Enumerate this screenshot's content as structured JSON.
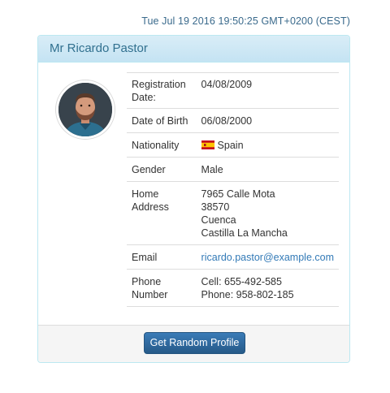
{
  "timestamp": "Tue Jul 19 2016 19:50:25 GMT+0200 (CEST)",
  "profile": {
    "name": "Mr Ricardo Pastor",
    "rows": {
      "registration": {
        "label": "Registration Date:",
        "value": "04/08/2009"
      },
      "dob": {
        "label": "Date of Birth",
        "value": "06/08/2000"
      },
      "nationality": {
        "label": "Nationality",
        "value": "Spain",
        "flag_icon": "spain-flag-icon"
      },
      "gender": {
        "label": "Gender",
        "value": "Male"
      },
      "address": {
        "label": "Home Address",
        "lines": [
          "7965 Calle Mota",
          "38570",
          "Cuenca",
          "Castilla La Mancha"
        ]
      },
      "email": {
        "label": "Email",
        "value": "ricardo.pastor@example.com"
      },
      "phone": {
        "label": "Phone Number",
        "cell": "Cell: 655-492-585",
        "phone": "Phone: 958-802-185"
      }
    }
  },
  "footer": {
    "button_label": "Get Random Profile"
  },
  "colors": {
    "header_bg": "#d9edf7",
    "header_text": "#31708f",
    "link": "#337ab7",
    "button": "#265a88",
    "timestamp": "#3a6a8c"
  }
}
